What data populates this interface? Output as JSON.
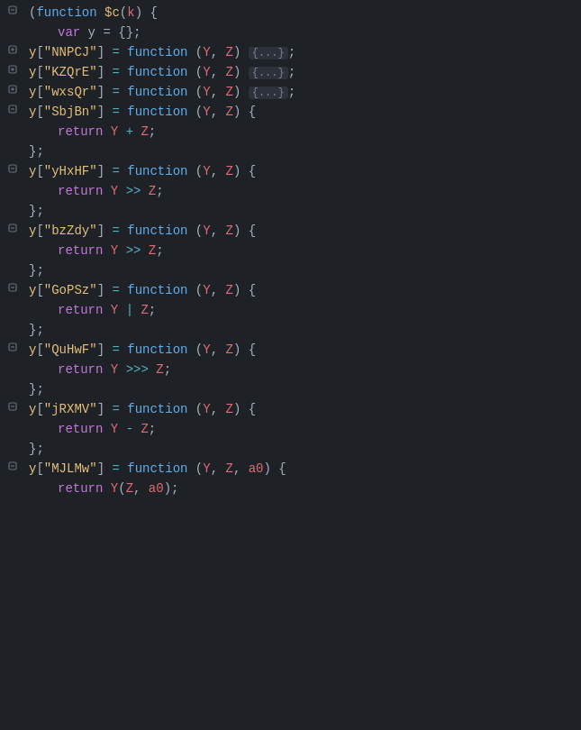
{
  "editor": {
    "background": "#1e2227",
    "lines": [
      {
        "id": 1,
        "gutter_type": "fold-open",
        "tokens": [
          {
            "type": "punc",
            "text": "("
          },
          {
            "type": "fn",
            "text": "function"
          },
          {
            "type": "punc",
            "text": " "
          },
          {
            "type": "def-key",
            "text": "$c"
          },
          {
            "type": "punc",
            "text": "("
          },
          {
            "type": "param",
            "text": "k"
          },
          {
            "type": "punc",
            "text": ") {"
          }
        ]
      },
      {
        "id": 2,
        "gutter_type": "fold-empty",
        "indent": 1,
        "tokens": [
          {
            "type": "kw",
            "text": "var"
          },
          {
            "type": "normal",
            "text": " y = {};"
          }
        ]
      },
      {
        "id": 3,
        "gutter_type": "fold-closed",
        "tokens": [
          {
            "type": "obj",
            "text": "y"
          },
          {
            "type": "punc",
            "text": "["
          },
          {
            "type": "str",
            "text": "\"NNPCJ\""
          },
          {
            "type": "punc",
            "text": "]"
          },
          {
            "type": "op",
            "text": " = "
          },
          {
            "type": "fn",
            "text": "function"
          },
          {
            "type": "punc",
            "text": " ("
          },
          {
            "type": "param",
            "text": "Y"
          },
          {
            "type": "punc",
            "text": ", "
          },
          {
            "type": "param",
            "text": "Z"
          },
          {
            "type": "punc",
            "text": ") "
          },
          {
            "type": "collapsed",
            "text": "{...}"
          },
          {
            "type": "punc",
            "text": ";"
          }
        ]
      },
      {
        "id": 4,
        "gutter_type": "fold-closed",
        "tokens": [
          {
            "type": "obj",
            "text": "y"
          },
          {
            "type": "punc",
            "text": "["
          },
          {
            "type": "str",
            "text": "\"KZQrE\""
          },
          {
            "type": "punc",
            "text": "]"
          },
          {
            "type": "op",
            "text": " = "
          },
          {
            "type": "fn",
            "text": "function"
          },
          {
            "type": "punc",
            "text": " ("
          },
          {
            "type": "param",
            "text": "Y"
          },
          {
            "type": "punc",
            "text": ", "
          },
          {
            "type": "param",
            "text": "Z"
          },
          {
            "type": "punc",
            "text": ") "
          },
          {
            "type": "collapsed",
            "text": "{...}"
          },
          {
            "type": "punc",
            "text": ";"
          }
        ]
      },
      {
        "id": 5,
        "gutter_type": "fold-closed",
        "tokens": [
          {
            "type": "obj",
            "text": "y"
          },
          {
            "type": "punc",
            "text": "["
          },
          {
            "type": "str",
            "text": "\"wxsQr\""
          },
          {
            "type": "punc",
            "text": "]"
          },
          {
            "type": "op",
            "text": " = "
          },
          {
            "type": "fn",
            "text": "function"
          },
          {
            "type": "punc",
            "text": " ("
          },
          {
            "type": "param",
            "text": "Y"
          },
          {
            "type": "punc",
            "text": ", "
          },
          {
            "type": "param",
            "text": "Z"
          },
          {
            "type": "punc",
            "text": ") "
          },
          {
            "type": "collapsed",
            "text": "{...}"
          },
          {
            "type": "punc",
            "text": ";"
          }
        ]
      },
      {
        "id": 6,
        "gutter_type": "fold-open",
        "tokens": [
          {
            "type": "obj",
            "text": "y"
          },
          {
            "type": "punc",
            "text": "["
          },
          {
            "type": "str",
            "text": "\"SbjBn\""
          },
          {
            "type": "punc",
            "text": "]"
          },
          {
            "type": "op",
            "text": " = "
          },
          {
            "type": "fn",
            "text": "function"
          },
          {
            "type": "punc",
            "text": " ("
          },
          {
            "type": "param",
            "text": "Y"
          },
          {
            "type": "punc",
            "text": ", "
          },
          {
            "type": "param",
            "text": "Z"
          },
          {
            "type": "punc",
            "text": ") {"
          }
        ]
      },
      {
        "id": 7,
        "gutter_type": "fold-empty",
        "indent": 1,
        "tokens": [
          {
            "type": "kw",
            "text": "return"
          },
          {
            "type": "normal",
            "text": " "
          },
          {
            "type": "param",
            "text": "Y"
          },
          {
            "type": "op",
            "text": " + "
          },
          {
            "type": "param",
            "text": "Z"
          },
          {
            "type": "punc",
            "text": ";"
          }
        ]
      },
      {
        "id": 8,
        "gutter_type": "fold-empty",
        "tokens": [
          {
            "type": "punc",
            "text": "};"
          }
        ]
      },
      {
        "id": 9,
        "gutter_type": "fold-open",
        "tokens": [
          {
            "type": "obj",
            "text": "y"
          },
          {
            "type": "punc",
            "text": "["
          },
          {
            "type": "str",
            "text": "\"yHxHF\""
          },
          {
            "type": "punc",
            "text": "]"
          },
          {
            "type": "op",
            "text": " = "
          },
          {
            "type": "fn",
            "text": "function"
          },
          {
            "type": "punc",
            "text": " ("
          },
          {
            "type": "param",
            "text": "Y"
          },
          {
            "type": "punc",
            "text": ", "
          },
          {
            "type": "param",
            "text": "Z"
          },
          {
            "type": "punc",
            "text": ") {"
          }
        ]
      },
      {
        "id": 10,
        "gutter_type": "fold-empty",
        "indent": 1,
        "tokens": [
          {
            "type": "kw",
            "text": "return"
          },
          {
            "type": "normal",
            "text": " "
          },
          {
            "type": "param",
            "text": "Y"
          },
          {
            "type": "op",
            "text": " >> "
          },
          {
            "type": "param",
            "text": "Z"
          },
          {
            "type": "punc",
            "text": ";"
          }
        ]
      },
      {
        "id": 11,
        "gutter_type": "fold-empty",
        "tokens": [
          {
            "type": "punc",
            "text": "};"
          }
        ]
      },
      {
        "id": 12,
        "gutter_type": "fold-open",
        "tokens": [
          {
            "type": "obj",
            "text": "y"
          },
          {
            "type": "punc",
            "text": "["
          },
          {
            "type": "str",
            "text": "\"bzZdy\""
          },
          {
            "type": "punc",
            "text": "]"
          },
          {
            "type": "op",
            "text": " = "
          },
          {
            "type": "fn",
            "text": "function"
          },
          {
            "type": "punc",
            "text": " ("
          },
          {
            "type": "param",
            "text": "Y"
          },
          {
            "type": "punc",
            "text": ", "
          },
          {
            "type": "param",
            "text": "Z"
          },
          {
            "type": "punc",
            "text": ") {"
          }
        ]
      },
      {
        "id": 13,
        "gutter_type": "fold-empty",
        "indent": 1,
        "tokens": [
          {
            "type": "kw",
            "text": "return"
          },
          {
            "type": "normal",
            "text": " "
          },
          {
            "type": "param",
            "text": "Y"
          },
          {
            "type": "op",
            "text": " >> "
          },
          {
            "type": "param",
            "text": "Z"
          },
          {
            "type": "punc",
            "text": ";"
          }
        ]
      },
      {
        "id": 14,
        "gutter_type": "fold-empty",
        "tokens": [
          {
            "type": "punc",
            "text": "};"
          }
        ]
      },
      {
        "id": 15,
        "gutter_type": "fold-open",
        "tokens": [
          {
            "type": "obj",
            "text": "y"
          },
          {
            "type": "punc",
            "text": "["
          },
          {
            "type": "str",
            "text": "\"GoPSz\""
          },
          {
            "type": "punc",
            "text": "]"
          },
          {
            "type": "op",
            "text": " = "
          },
          {
            "type": "fn",
            "text": "function"
          },
          {
            "type": "punc",
            "text": " ("
          },
          {
            "type": "param",
            "text": "Y"
          },
          {
            "type": "punc",
            "text": ", "
          },
          {
            "type": "param",
            "text": "Z"
          },
          {
            "type": "punc",
            "text": ") {"
          }
        ]
      },
      {
        "id": 16,
        "gutter_type": "fold-empty",
        "indent": 1,
        "tokens": [
          {
            "type": "kw",
            "text": "return"
          },
          {
            "type": "normal",
            "text": " "
          },
          {
            "type": "param",
            "text": "Y"
          },
          {
            "type": "op",
            "text": " | "
          },
          {
            "type": "param",
            "text": "Z"
          },
          {
            "type": "punc",
            "text": ";"
          }
        ]
      },
      {
        "id": 17,
        "gutter_type": "fold-empty",
        "tokens": [
          {
            "type": "punc",
            "text": "};"
          }
        ]
      },
      {
        "id": 18,
        "gutter_type": "fold-open",
        "tokens": [
          {
            "type": "obj",
            "text": "y"
          },
          {
            "type": "punc",
            "text": "["
          },
          {
            "type": "str",
            "text": "\"QuHwF\""
          },
          {
            "type": "punc",
            "text": "]"
          },
          {
            "type": "op",
            "text": " = "
          },
          {
            "type": "fn",
            "text": "function"
          },
          {
            "type": "punc",
            "text": " ("
          },
          {
            "type": "param",
            "text": "Y"
          },
          {
            "type": "punc",
            "text": ", "
          },
          {
            "type": "param",
            "text": "Z"
          },
          {
            "type": "punc",
            "text": ") {"
          }
        ]
      },
      {
        "id": 19,
        "gutter_type": "fold-empty",
        "indent": 1,
        "tokens": [
          {
            "type": "kw",
            "text": "return"
          },
          {
            "type": "normal",
            "text": " "
          },
          {
            "type": "param",
            "text": "Y"
          },
          {
            "type": "op",
            "text": " >>> "
          },
          {
            "type": "param",
            "text": "Z"
          },
          {
            "type": "punc",
            "text": ";"
          }
        ]
      },
      {
        "id": 20,
        "gutter_type": "fold-empty",
        "tokens": [
          {
            "type": "punc",
            "text": "};"
          }
        ]
      },
      {
        "id": 21,
        "gutter_type": "fold-open",
        "tokens": [
          {
            "type": "obj",
            "text": "y"
          },
          {
            "type": "punc",
            "text": "["
          },
          {
            "type": "str",
            "text": "\"jRXMV\""
          },
          {
            "type": "punc",
            "text": "]"
          },
          {
            "type": "op",
            "text": " = "
          },
          {
            "type": "fn",
            "text": "function"
          },
          {
            "type": "punc",
            "text": " ("
          },
          {
            "type": "param",
            "text": "Y"
          },
          {
            "type": "punc",
            "text": ", "
          },
          {
            "type": "param",
            "text": "Z"
          },
          {
            "type": "punc",
            "text": ") {"
          }
        ]
      },
      {
        "id": 22,
        "gutter_type": "fold-empty",
        "indent": 1,
        "tokens": [
          {
            "type": "kw",
            "text": "return"
          },
          {
            "type": "normal",
            "text": " "
          },
          {
            "type": "param",
            "text": "Y"
          },
          {
            "type": "op",
            "text": " - "
          },
          {
            "type": "param",
            "text": "Z"
          },
          {
            "type": "punc",
            "text": ";"
          }
        ]
      },
      {
        "id": 23,
        "gutter_type": "fold-empty",
        "tokens": [
          {
            "type": "punc",
            "text": "};"
          }
        ]
      },
      {
        "id": 24,
        "gutter_type": "fold-open",
        "tokens": [
          {
            "type": "obj",
            "text": "y"
          },
          {
            "type": "punc",
            "text": "["
          },
          {
            "type": "str",
            "text": "\"MJLMw\""
          },
          {
            "type": "punc",
            "text": "]"
          },
          {
            "type": "op",
            "text": " = "
          },
          {
            "type": "fn",
            "text": "function"
          },
          {
            "type": "punc",
            "text": " ("
          },
          {
            "type": "param",
            "text": "Y"
          },
          {
            "type": "punc",
            "text": ", "
          },
          {
            "type": "param",
            "text": "Z"
          },
          {
            "type": "punc",
            "text": ", "
          },
          {
            "type": "param",
            "text": "a0"
          },
          {
            "type": "punc",
            "text": ") {"
          }
        ]
      },
      {
        "id": 25,
        "gutter_type": "fold-empty",
        "indent": 1,
        "tokens": [
          {
            "type": "kw",
            "text": "return"
          },
          {
            "type": "normal",
            "text": " "
          },
          {
            "type": "param",
            "text": "Y"
          },
          {
            "type": "punc",
            "text": "("
          },
          {
            "type": "param",
            "text": "Z"
          },
          {
            "type": "punc",
            "text": ","
          },
          {
            "type": "normal",
            "text": " "
          },
          {
            "type": "param",
            "text": "a0"
          },
          {
            "type": "punc",
            "text": ");"
          }
        ]
      }
    ]
  }
}
